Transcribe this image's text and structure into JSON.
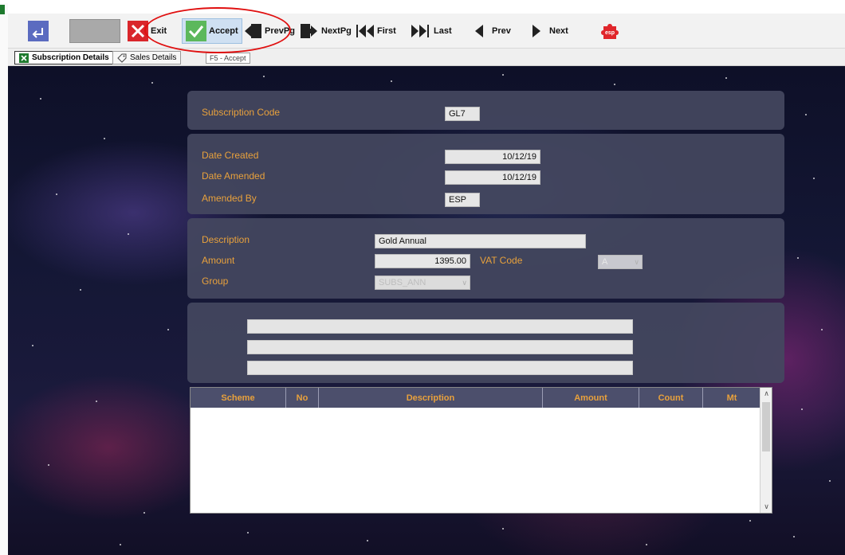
{
  "toolbar": {
    "exit_label": "Exit",
    "accept_label": "Accept",
    "prevpg_label": "PrevPg",
    "nextpg_label": "NextPg",
    "first_label": "First",
    "last_label": "Last",
    "prev_label": "Prev",
    "next_label": "Next",
    "logo_text": "esp"
  },
  "tabs": [
    {
      "label": "Subscription Details",
      "icon": "spreadsheet-icon",
      "active": true
    },
    {
      "label": "Sales Details",
      "icon": "tag-icon",
      "active": false
    }
  ],
  "tooltip": "F5 - Accept",
  "form": {
    "subscription_code_label": "Subscription Code",
    "subscription_code": "GL7",
    "date_created_label": "Date Created",
    "date_created": "10/12/19",
    "date_amended_label": "Date Amended",
    "date_amended": "10/12/19",
    "amended_by_label": "Amended By",
    "amended_by": "ESP",
    "description_label": "Description",
    "description": "Gold Annual",
    "amount_label": "Amount",
    "amount": "1395.00",
    "vat_code_label": "VAT Code",
    "vat_code": "A",
    "group_label": "Group",
    "group": "SUBS_ANN"
  },
  "grid": {
    "columns": [
      "Scheme",
      "No",
      "Description",
      "Amount",
      "Count",
      "Mt"
    ],
    "rows": []
  },
  "colors": {
    "label_orange": "#e8a13c",
    "panel": "#444860",
    "highlight": "#e01010",
    "accent_green": "#1e7a2e"
  }
}
